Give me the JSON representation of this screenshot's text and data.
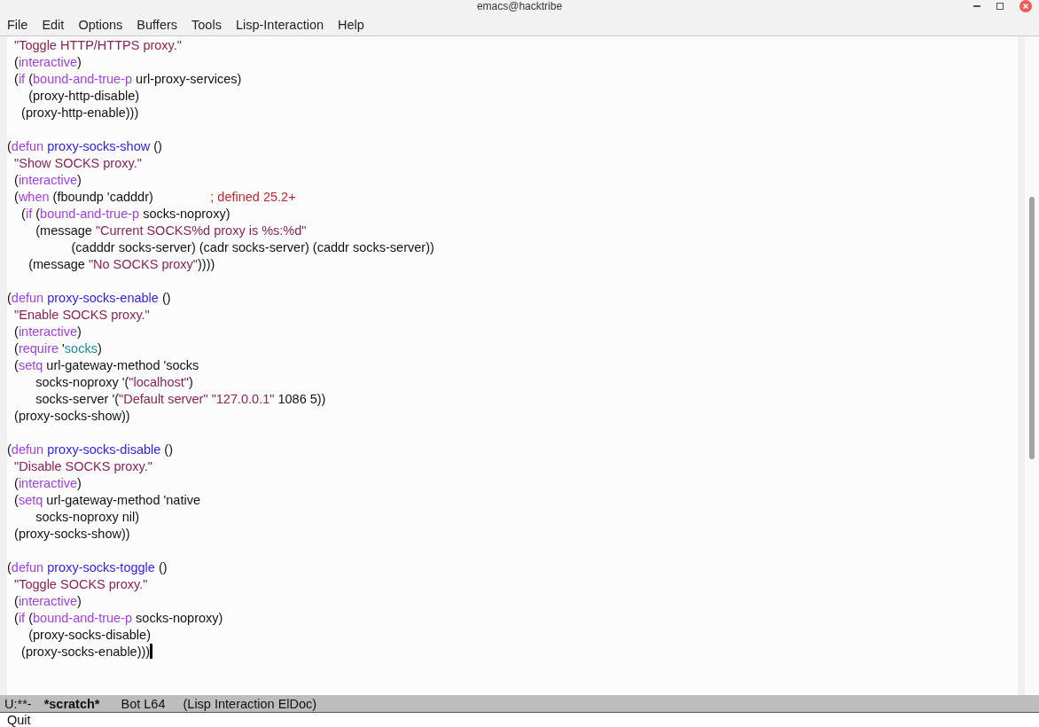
{
  "window": {
    "title": "emacs@hacktribe"
  },
  "menu_bar": [
    "File",
    "Edit",
    "Options",
    "Buffers",
    "Tools",
    "Lisp-Interaction",
    "Help"
  ],
  "buffer": {
    "blocks": [
      {
        "lines": [
          [
            {
              "kind": "string",
              "text": "  \"Toggle HTTP/HTTPS proxy.\""
            }
          ],
          [
            {
              "kind": "plain",
              "text": "  ("
            },
            {
              "kind": "keyword",
              "text": "interactive"
            },
            {
              "kind": "plain",
              "text": ")"
            }
          ],
          [
            {
              "kind": "plain",
              "text": "  ("
            },
            {
              "kind": "keyword",
              "text": "if"
            },
            {
              "kind": "plain",
              "text": " ("
            },
            {
              "kind": "keyword",
              "text": "bound-and-true-p"
            },
            {
              "kind": "plain",
              "text": " url-proxy-services)"
            }
          ],
          [
            {
              "kind": "plain",
              "text": "      (proxy-http-disable)"
            }
          ],
          [
            {
              "kind": "plain",
              "text": "    (proxy-http-enable)))"
            }
          ]
        ]
      },
      {
        "lines": [
          [
            {
              "kind": "plain",
              "text": "("
            },
            {
              "kind": "keyword",
              "text": "defun "
            },
            {
              "kind": "function",
              "text": "proxy-socks-show"
            },
            {
              "kind": "plain",
              "text": " ()"
            }
          ],
          [
            {
              "kind": "string",
              "text": "  \"Show SOCKS proxy.\""
            }
          ],
          [
            {
              "kind": "plain",
              "text": "  ("
            },
            {
              "kind": "keyword",
              "text": "interactive"
            },
            {
              "kind": "plain",
              "text": ")"
            }
          ],
          [
            {
              "kind": "plain",
              "text": "  ("
            },
            {
              "kind": "keyword",
              "text": "when"
            },
            {
              "kind": "plain",
              "text": " (fboundp 'cadddr)                "
            },
            {
              "kind": "comment",
              "text": "; defined 25.2+"
            }
          ],
          [
            {
              "kind": "plain",
              "text": "    ("
            },
            {
              "kind": "keyword",
              "text": "if"
            },
            {
              "kind": "plain",
              "text": " ("
            },
            {
              "kind": "keyword",
              "text": "bound-and-true-p"
            },
            {
              "kind": "plain",
              "text": " socks-noproxy)"
            }
          ],
          [
            {
              "kind": "plain",
              "text": "        (message "
            },
            {
              "kind": "string",
              "text": "\"Current SOCKS%d proxy is %s:%d\""
            }
          ],
          [
            {
              "kind": "plain",
              "text": "                  (cadddr socks-server) (cadr socks-server) (caddr socks-server))"
            }
          ],
          [
            {
              "kind": "plain",
              "text": "      (message "
            },
            {
              "kind": "string",
              "text": "\"No SOCKS proxy\""
            },
            {
              "kind": "plain",
              "text": "))))"
            }
          ]
        ]
      },
      {
        "lines": [
          [
            {
              "kind": "plain",
              "text": "("
            },
            {
              "kind": "keyword",
              "text": "defun "
            },
            {
              "kind": "function",
              "text": "proxy-socks-enable"
            },
            {
              "kind": "plain",
              "text": " ()"
            }
          ],
          [
            {
              "kind": "string",
              "text": "  \"Enable SOCKS proxy.\""
            }
          ],
          [
            {
              "kind": "plain",
              "text": "  ("
            },
            {
              "kind": "keyword",
              "text": "interactive"
            },
            {
              "kind": "plain",
              "text": ")"
            }
          ],
          [
            {
              "kind": "plain",
              "text": "  ("
            },
            {
              "kind": "keyword",
              "text": "require"
            },
            {
              "kind": "plain",
              "text": " '"
            },
            {
              "kind": "constant",
              "text": "socks"
            },
            {
              "kind": "plain",
              "text": ")"
            }
          ],
          [
            {
              "kind": "plain",
              "text": "  ("
            },
            {
              "kind": "keyword",
              "text": "setq"
            },
            {
              "kind": "plain",
              "text": " url-gateway-method 'socks"
            }
          ],
          [
            {
              "kind": "plain",
              "text": "        socks-noproxy '("
            },
            {
              "kind": "string",
              "text": "\"localhost\""
            },
            {
              "kind": "plain",
              "text": ")"
            }
          ],
          [
            {
              "kind": "plain",
              "text": "        socks-server '("
            },
            {
              "kind": "string",
              "text": "\"Default server\" \"127.0.0.1\""
            },
            {
              "kind": "plain",
              "text": " 1086 5))"
            }
          ],
          [
            {
              "kind": "plain",
              "text": "  (proxy-socks-show))"
            }
          ]
        ]
      },
      {
        "lines": [
          [
            {
              "kind": "plain",
              "text": "("
            },
            {
              "kind": "keyword",
              "text": "defun "
            },
            {
              "kind": "function",
              "text": "proxy-socks-disable"
            },
            {
              "kind": "plain",
              "text": " ()"
            }
          ],
          [
            {
              "kind": "string",
              "text": "  \"Disable SOCKS proxy.\""
            }
          ],
          [
            {
              "kind": "plain",
              "text": "  ("
            },
            {
              "kind": "keyword",
              "text": "interactive"
            },
            {
              "kind": "plain",
              "text": ")"
            }
          ],
          [
            {
              "kind": "plain",
              "text": "  ("
            },
            {
              "kind": "keyword",
              "text": "setq"
            },
            {
              "kind": "plain",
              "text": " url-gateway-method 'native"
            }
          ],
          [
            {
              "kind": "plain",
              "text": "        socks-noproxy nil)"
            }
          ],
          [
            {
              "kind": "plain",
              "text": "  (proxy-socks-show))"
            }
          ]
        ]
      },
      {
        "lines": [
          [
            {
              "kind": "plain",
              "text": "("
            },
            {
              "kind": "keyword",
              "text": "defun "
            },
            {
              "kind": "function",
              "text": "proxy-socks-toggle"
            },
            {
              "kind": "plain",
              "text": " ()"
            }
          ],
          [
            {
              "kind": "string",
              "text": "  \"Toggle SOCKS proxy.\""
            }
          ],
          [
            {
              "kind": "plain",
              "text": "  ("
            },
            {
              "kind": "keyword",
              "text": "interactive"
            },
            {
              "kind": "plain",
              "text": ")"
            }
          ],
          [
            {
              "kind": "plain",
              "text": "  ("
            },
            {
              "kind": "keyword",
              "text": "if"
            },
            {
              "kind": "plain",
              "text": " ("
            },
            {
              "kind": "keyword",
              "text": "bound-and-true-p"
            },
            {
              "kind": "plain",
              "text": " socks-noproxy)"
            }
          ],
          [
            {
              "kind": "plain",
              "text": "      (proxy-socks-disable)"
            }
          ],
          [
            {
              "kind": "plain",
              "text": "    (proxy-socks-enable)))"
            }
          ]
        ]
      }
    ],
    "cursor_after_last_line": true
  },
  "mode_line": {
    "status": "U:**-",
    "buffer_name": "*scratch*",
    "position": "Bot L64",
    "modes": "(Lisp Interaction ElDoc)"
  },
  "echo_area": "Quit"
}
